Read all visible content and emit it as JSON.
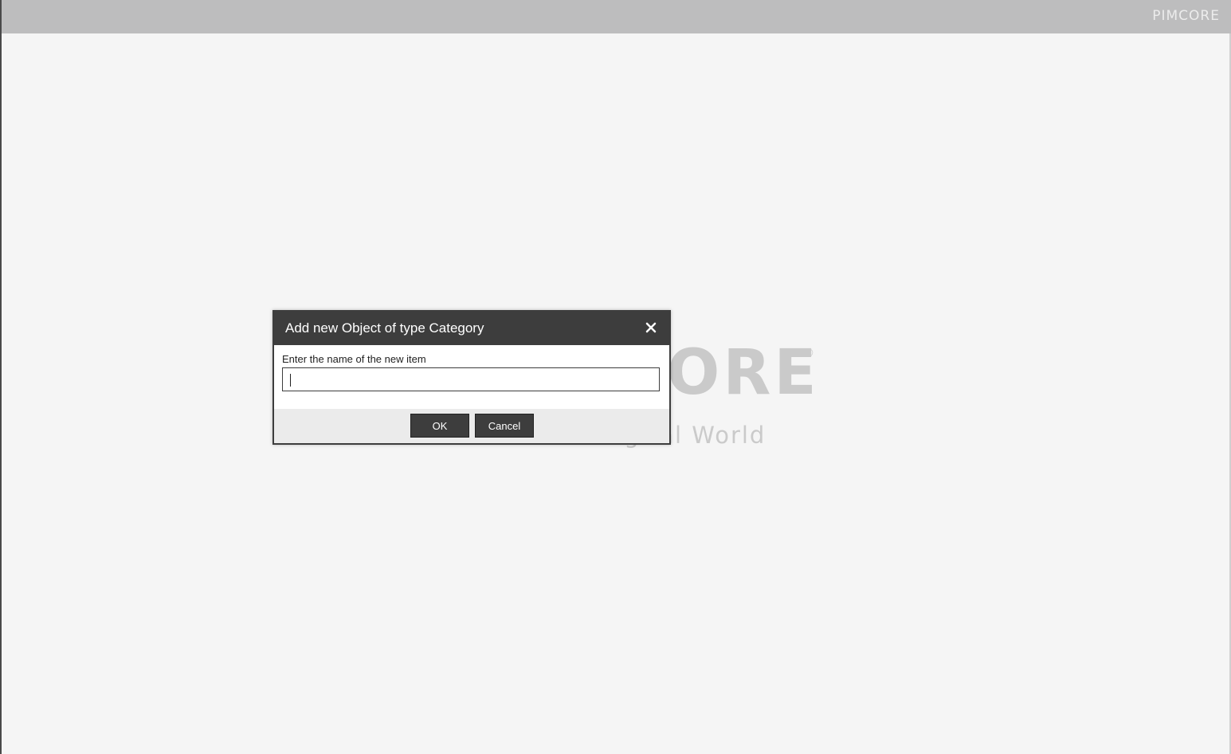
{
  "topbar": {
    "logo_text": "PIMCORE"
  },
  "splash": {
    "logo_text": "PIMCORE",
    "registered_mark": "®",
    "tagline": "Own the Digital World"
  },
  "dialog": {
    "title": "Add new Object of type Category",
    "close_icon": "close-icon",
    "field_label": "Enter the name of the new item",
    "input_value": "",
    "input_placeholder": "",
    "ok_label": "OK",
    "cancel_label": "Cancel"
  },
  "colors": {
    "topbar_bg": "#bdbdbe",
    "dialog_header_bg": "#3d3d3d",
    "button_bg": "#3d3d3d",
    "page_bg": "#f5f5f5"
  }
}
